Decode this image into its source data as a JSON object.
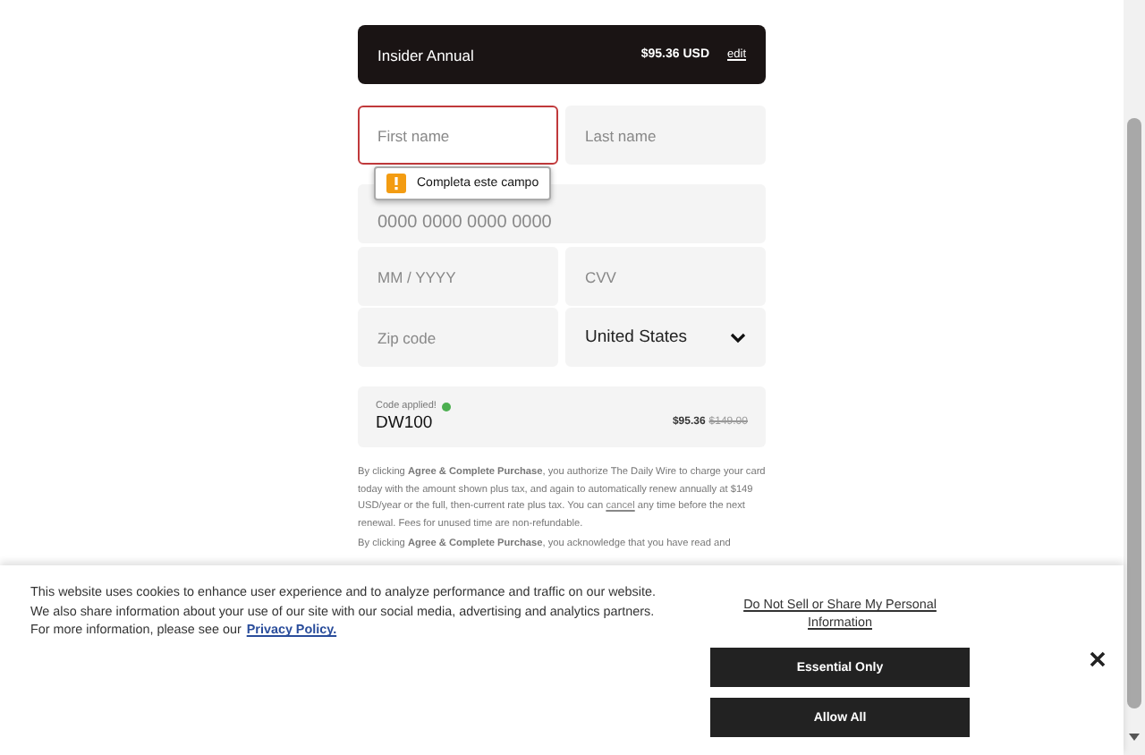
{
  "plan": {
    "name": "Insider Annual",
    "price": "$95.36 USD",
    "edit": "edit"
  },
  "fields": [
    {
      "placeholder": "First name",
      "error": true
    },
    {
      "placeholder": "Last name",
      "error": false
    }
  ],
  "tooltip": {
    "text": "Completa este campo"
  },
  "card_number": {
    "placeholder": "0000 0000 0000 0000"
  },
  "expiry": {
    "placeholder": "MM / YYYY"
  },
  "cvv": {
    "placeholder": "CVV"
  },
  "zip": {
    "placeholder": "Zip code"
  },
  "country": {
    "value": "United States"
  },
  "promo": {
    "label": "Code applied!",
    "code": "DW100",
    "price": "$95.36",
    "old_price": "$149.00"
  },
  "legal": [
    "By clicking **Agree & Complete Purchase**, you authorize The Daily Wire to charge your card today with the amount shown plus tax, and again to automatically renew annually at $149 USD/year or the full, then-current rate plus tax. You can ",
    "cancel",
    " any time before the next renewal. Fees for unused time are non-refundable."
  ],
  "legal_2": "By clicking **Agree & Complete Purchase**, you acknowledge that you have read and",
  "cookie": {
    "text": "This website uses cookies to enhance user experience and to analyze performance and traffic on our website. We also share information about your use of our site with our social media, advertising and analytics partners. For more information, please see our",
    "policy": "Privacy Policy.",
    "do_not_sell": "Do Not Sell or Share My Personal Information",
    "buttons": [
      "Essential Only",
      "Allow All"
    ]
  }
}
